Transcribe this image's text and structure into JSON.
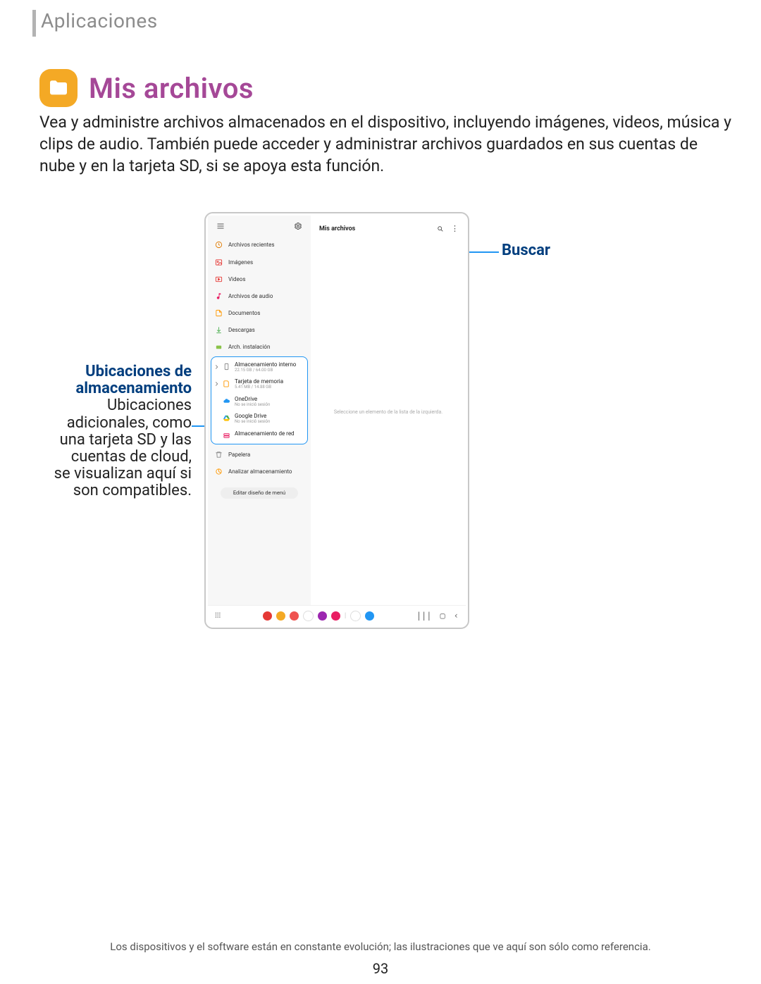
{
  "header": {
    "section": "Aplicaciones"
  },
  "title": "Mis archivos",
  "body": "Vea y administre archivos almacenados en el dispositivo, incluyendo imágenes, videos, música y clips de audio. También puede acceder y administrar archivos guardados en sus cuentas de nube y en la tarjeta SD, si se apoya esta función.",
  "callouts": {
    "search_label": "Buscar",
    "storage_title_l1": "Ubicaciones de",
    "storage_title_l2": "almacenamiento",
    "storage_desc_l1": "Ubicaciones",
    "storage_desc_l2": "adicionales, como",
    "storage_desc_l3": "una tarjeta SD y las",
    "storage_desc_l4": "cuentas de cloud,",
    "storage_desc_l5": "se visualizan aquí si",
    "storage_desc_l6": "son compatibles."
  },
  "device": {
    "app_title": "Mis archivos",
    "placeholder": "Seleccione un elemento de la lista de la izquierda.",
    "sidebar": {
      "recent": "Archivos recientes",
      "images": "Imágenes",
      "videos": "Videos",
      "audio": "Archivos de audio",
      "documents": "Documentos",
      "downloads": "Descargas",
      "apk": "Arch. instalación",
      "trash": "Papelera",
      "analyze": "Analizar almacenamiento",
      "edit_menu": "Editar diseño de menú"
    },
    "storage": {
      "internal_label": "Almacenamiento interno",
      "internal_sub": "22.15 GB / 64.00 GB",
      "sdcard_label": "Tarjeta de memoria",
      "sdcard_sub": "5.41 MB / 14.88 GB",
      "onedrive_label": "OneDrive",
      "onedrive_sub": "No se inició sesión",
      "gdrive_label": "Google Drive",
      "gdrive_sub": "No se inició sesión",
      "network_label": "Almacenamiento de red"
    }
  },
  "disclaimer": "Los dispositivos y el software están en constante evolución; las ilustraciones que ve aquí son sólo como referencia.",
  "page_number": "93"
}
